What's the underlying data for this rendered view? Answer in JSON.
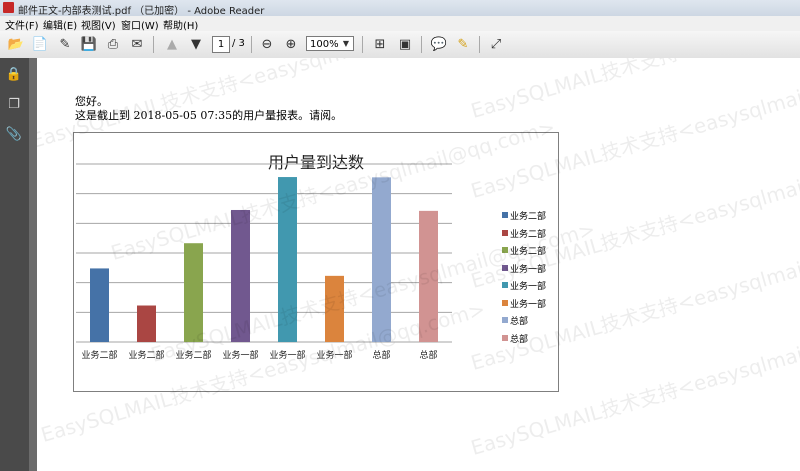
{
  "window": {
    "title": "邮件正文-内部表测试.pdf （已加密） - Adobe Reader"
  },
  "menu": {
    "items": [
      "文件(F)",
      "编辑(E)",
      "视图(V)",
      "窗口(W)",
      "帮助(H)"
    ]
  },
  "toolbar": {
    "page_current": "1",
    "page_total": "/ 3",
    "zoom": "100%"
  },
  "document": {
    "greeting": "您好。",
    "report_line": "这是截止到 2018-05-05 07:35的用户量报表。请阅。"
  },
  "watermark": {
    "text": "EasySQLMAIL技术支持<easysqlmail@qq.com>"
  },
  "chart_data": {
    "type": "bar",
    "title": "用户量到达数",
    "categories": [
      "业务二部",
      "业务二部",
      "业务二部",
      "业务一部",
      "业务一部",
      "业务一部",
      "总部",
      "总部"
    ],
    "values": [
      2480,
      1230,
      3330,
      4450,
      5560,
      2230,
      5550,
      4420
    ],
    "colors": [
      "#4572a7",
      "#aa4643",
      "#89a54e",
      "#71588f",
      "#4198af",
      "#db843d",
      "#93a9cf",
      "#d19392"
    ],
    "legend": [
      "业务二部",
      "业务二部",
      "业务二部",
      "业务一部",
      "业务一部",
      "业务一部",
      "总部",
      "总部"
    ],
    "legend_position": "right",
    "ylim": [
      0,
      6000
    ],
    "yticks": [
      0,
      1000,
      2000,
      3000,
      4000,
      5000,
      6000
    ],
    "grid": true
  }
}
